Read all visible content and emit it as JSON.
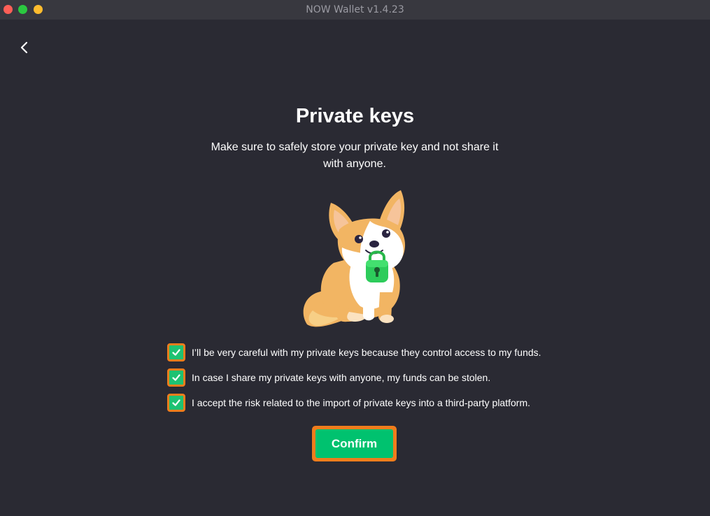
{
  "window": {
    "title": "NOW Wallet v1.4.23"
  },
  "nav": {
    "back_icon": "chevron-left-icon"
  },
  "main": {
    "heading": "Private keys",
    "subtitle": "Make sure to safely store your private key and not share it with anyone.",
    "illustration": "corgi-with-padlock",
    "checkboxes": [
      {
        "label": "I’ll be very careful with my private keys because they control access to my funds.",
        "checked": true
      },
      {
        "label": "In case I share my private keys with anyone, my funds can be stolen.",
        "checked": true
      },
      {
        "label": "I accept the risk related to the import of private keys into a third-party platform.",
        "checked": true
      }
    ],
    "confirm_label": "Confirm"
  },
  "colors": {
    "background": "#2a2a33",
    "titlebar": "#38383f",
    "accent_green": "#00c26f",
    "highlight_orange": "#f07d1c",
    "text": "#ffffff"
  }
}
